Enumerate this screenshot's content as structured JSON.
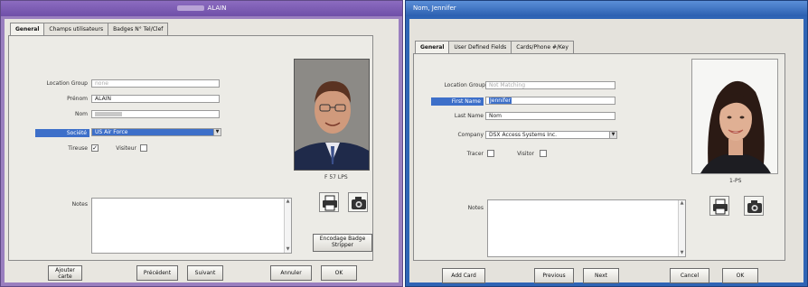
{
  "left_window": {
    "title": "ALAIN",
    "tabs": [
      "General",
      "Champs utilisateurs",
      "Badges N° Tel/Clef"
    ],
    "fields": {
      "location_group_label": "Location Group",
      "location_group_value": "none",
      "prenom_label": "Prénom",
      "prenom_value": "ALAIN",
      "nom_label": "Nom",
      "societe_label": "Société",
      "societe_value": "US Air Force",
      "tireuse_label": "Tireuse",
      "visiteur_label": "Visiteur",
      "tireuse_checked": "✓",
      "visiteur_checked": ""
    },
    "photo_caption": "F 57 LPS",
    "notes_label": "Notes",
    "encode_button": "Encodage Badge Stripper",
    "buttons": [
      "Ajouter carte",
      "Précédent",
      "Suivant",
      "Annuler",
      "OK"
    ]
  },
  "right_window": {
    "title": "Nom, Jennifer",
    "tabs": [
      "General",
      "User Defined Fields",
      "Cards/Phone #/Key"
    ],
    "fields": {
      "location_group_label": "Location Group",
      "location_group_value": "Not Matching",
      "first_name_label": "First Name",
      "first_name_value": "Jennifer",
      "last_name_label": "Last Name",
      "last_name_value": "Nom",
      "company_label": "Company",
      "company_value": "DSX Access Systems Inc.",
      "tracer_label": "Tracer",
      "visitor_label": "Visitor"
    },
    "photo_caption": "1-PS",
    "notes_label": "Notes",
    "buttons": [
      "Add Card",
      "Previous",
      "Next",
      "Cancel",
      "OK"
    ]
  },
  "colors": {
    "left_frame": "#9a7fbf",
    "right_frame": "#2f64b5",
    "highlight": "#3d6fc9"
  },
  "icons": [
    "printer-icon",
    "camera-icon",
    "scroll-up-icon",
    "scroll-down-icon",
    "combo-arrow-icon"
  ]
}
